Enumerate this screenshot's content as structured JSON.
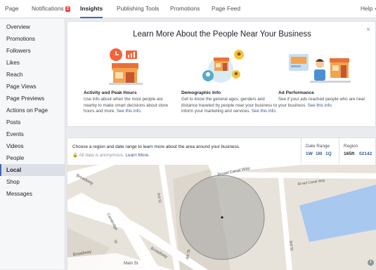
{
  "topnav": {
    "items": [
      {
        "label": "Page"
      },
      {
        "label": "Notifications",
        "badge": "2"
      },
      {
        "label": "Insights"
      },
      {
        "label": "Publishing Tools"
      },
      {
        "label": "Promotions"
      },
      {
        "label": "Page Feed"
      }
    ],
    "help": "Help"
  },
  "sidebar": {
    "items": [
      {
        "label": "Overview"
      },
      {
        "label": "Promotions"
      },
      {
        "label": "Followers"
      },
      {
        "label": "Likes"
      },
      {
        "label": "Reach"
      },
      {
        "label": "Page Views"
      },
      {
        "label": "Page Previews"
      },
      {
        "label": "Actions on Page"
      },
      {
        "label": "Posts"
      },
      {
        "label": "Events"
      },
      {
        "label": "Videos"
      },
      {
        "label": "People"
      },
      {
        "label": "Local"
      },
      {
        "label": "Shop"
      },
      {
        "label": "Messages"
      }
    ],
    "active": "Local"
  },
  "learn": {
    "title": "Learn More About the People Near Your Business",
    "close": "×",
    "cols": [
      {
        "heading": "Activity and Peak Hours",
        "text": "Use info about when the most people are nearby to make smart decisions about store hours and more.",
        "link": "See this info."
      },
      {
        "heading": "Demographic Info",
        "text": "Get to know the general ages, genders and distance traveled by people near your business to inform your marketing and services.",
        "link": "See this info."
      },
      {
        "heading": "Ad Performance",
        "text": "See if your ads reached people who are near your business.",
        "link": "See this info."
      }
    ]
  },
  "panel": {
    "prompt": "Choose a region and date range to learn more about the area around your business.",
    "anon_text": "All data is anonymous.",
    "anon_link": "Learn More.",
    "date_range": {
      "label": "Date Range",
      "options": [
        "1W",
        "1M",
        "1Q"
      ]
    },
    "region": {
      "label": "Region",
      "radius": "165ft",
      "zip": "02142"
    }
  },
  "map": {
    "streets": [
      "Broad Canal Way",
      "Broad Canal Way",
      "Broadway",
      "Broadway",
      "Cambridge",
      "St",
      "3rd St",
      "Main St",
      "6th St",
      "3rd St",
      "Broadway"
    ],
    "water_color": "#a8c8f0",
    "radius_color": "#9a9a9a",
    "info_icon": "i"
  },
  "colors": {
    "accent": "#4267b2",
    "link": "#365899",
    "badge": "#fa3e3e"
  }
}
